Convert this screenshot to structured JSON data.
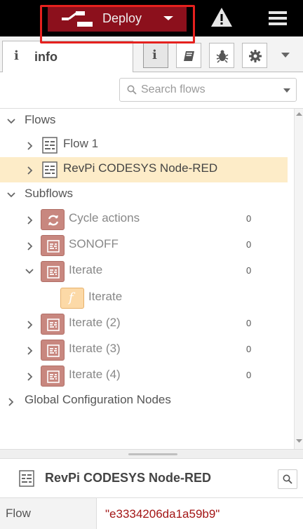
{
  "header": {
    "deploy_label": "Deploy",
    "icons": [
      "deploy-icon",
      "caret-down-icon",
      "warning-icon",
      "hamburger-menu-icon"
    ]
  },
  "sidebar_tabs": {
    "active_tab_label": "info",
    "tools": [
      "info-icon",
      "book-icon",
      "bug-icon",
      "gear-icon"
    ]
  },
  "search": {
    "placeholder": "Search flows"
  },
  "tree": {
    "flows_heading": "Flows",
    "flows": [
      {
        "label": "Flow 1",
        "selected": false
      },
      {
        "label": "RevPi CODESYS Node-RED",
        "selected": true
      }
    ],
    "subflows_heading": "Subflows",
    "subflows": [
      {
        "label": "Cycle actions",
        "count": "0",
        "icon": "refresh-icon",
        "expanded": false
      },
      {
        "label": "SONOFF",
        "count": "0",
        "icon": "subflow-icon",
        "expanded": false
      },
      {
        "label": "Iterate",
        "count": "0",
        "icon": "subflow-icon",
        "expanded": true,
        "child": {
          "label": "Iterate",
          "icon": "function-icon",
          "glyph": "f"
        }
      },
      {
        "label": "Iterate (2)",
        "count": "0",
        "icon": "subflow-icon",
        "expanded": false
      },
      {
        "label": "Iterate (3)",
        "count": "0",
        "icon": "subflow-icon",
        "expanded": false
      },
      {
        "label": "Iterate (4)",
        "count": "0",
        "icon": "subflow-icon",
        "expanded": false
      }
    ],
    "global_config_heading": "Global Configuration Nodes"
  },
  "info_panel": {
    "title": "RevPi CODESYS Node-RED",
    "properties": [
      {
        "key": "Flow",
        "value": "\"e3334206da1a59b9\""
      }
    ]
  },
  "colors": {
    "header_bg": "#000000",
    "deploy_bg": "#8c101c",
    "highlight_border": "#e5211e",
    "selected_row_bg": "#fdecc8",
    "subflow_icon_bg": "#c8877f",
    "function_icon_bg": "#fcd9a7",
    "property_value": "#a31515"
  }
}
